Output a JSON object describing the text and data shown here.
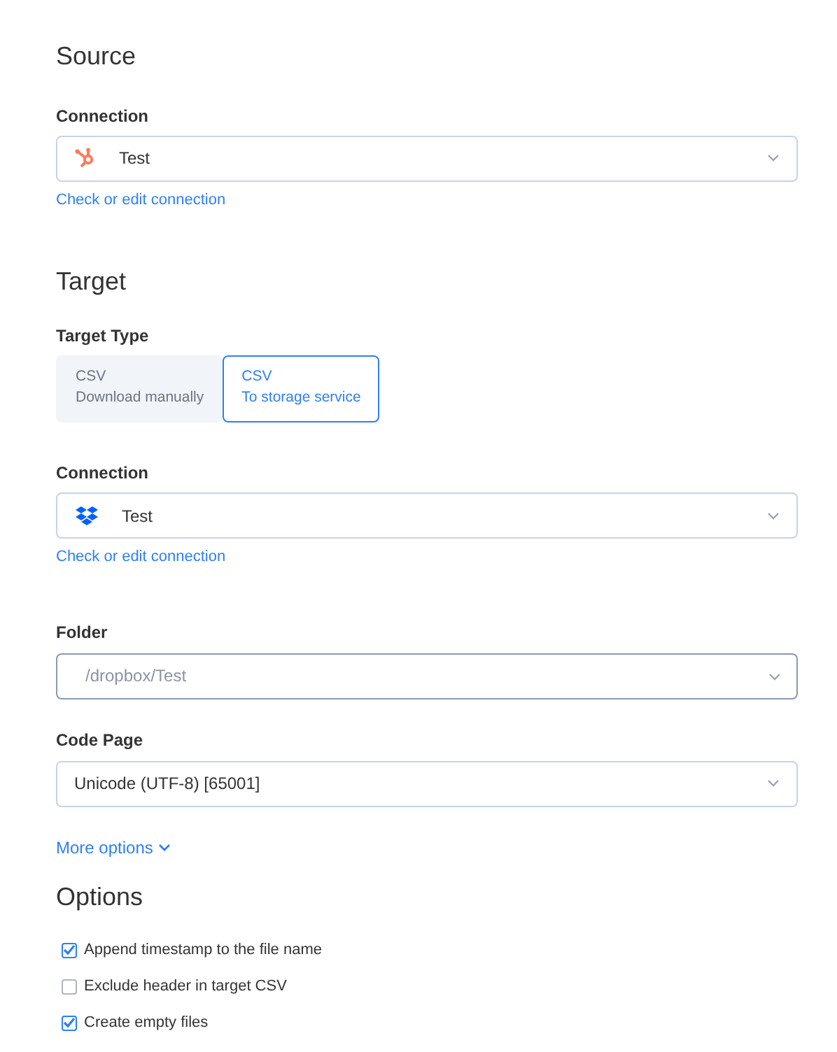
{
  "source": {
    "heading": "Source",
    "connection": {
      "label": "Connection",
      "value": "Test",
      "link": "Check or edit connection"
    }
  },
  "target": {
    "heading": "Target",
    "target_type": {
      "label": "Target Type",
      "options": [
        {
          "title": "CSV",
          "subtitle": "Download manually",
          "selected": false
        },
        {
          "title": "CSV",
          "subtitle": "To storage service",
          "selected": true
        }
      ]
    },
    "connection": {
      "label": "Connection",
      "value": "Test",
      "link": "Check or edit connection"
    },
    "folder": {
      "label": "Folder",
      "placeholder": "/dropbox/Test"
    },
    "code_page": {
      "label": "Code Page",
      "value": "Unicode (UTF-8) [65001]"
    },
    "more_options": "More options"
  },
  "options": {
    "heading": "Options",
    "items": [
      {
        "label": "Append timestamp to the file name",
        "checked": true
      },
      {
        "label": "Exclude header in target CSV",
        "checked": false
      },
      {
        "label": "Create empty files",
        "checked": true
      }
    ]
  }
}
